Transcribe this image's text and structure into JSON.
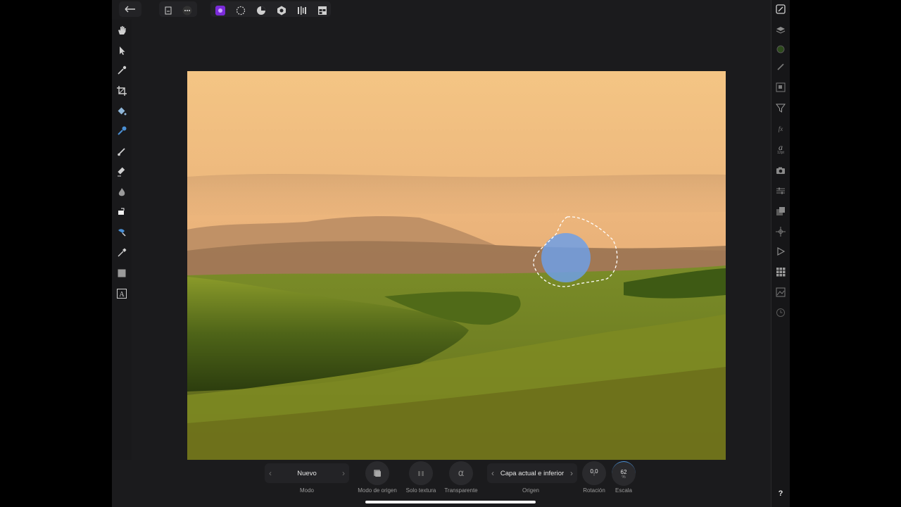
{
  "topbar": {
    "back_icon": "arrow-left-icon",
    "document_icon": "document-icon",
    "more_icon": "ellipsis-icon",
    "personas": [
      "photo-persona-icon",
      "liquify-persona-icon",
      "develop-persona-icon",
      "tone-map-persona-icon",
      "export-persona-icon",
      "grid-layout-icon"
    ],
    "accent": "#7b2bd9"
  },
  "left_tools": [
    "hand-icon",
    "move-icon",
    "color-picker-icon",
    "crop-icon",
    "fill-icon",
    "selection-brush-icon",
    "paint-brush-icon",
    "eraser-icon",
    "burn-icon",
    "clone-icon",
    "healing-icon",
    "pen-icon",
    "rectangle-icon",
    "text-icon"
  ],
  "right_tools": [
    "history-icon",
    "layers-icon",
    "color-icon",
    "brushes-icon",
    "navigator-icon",
    "filter-icon",
    "fx-icon",
    "text-styles-icon",
    "camera-icon",
    "adjustments-icon",
    "channels-icon",
    "transform-icon",
    "play-icon",
    "stock-icon",
    "image-icon",
    "clock-icon",
    "help-icon"
  ],
  "text_style_size": "12pt",
  "help_label": "?",
  "context": {
    "mode": {
      "value": "Nuevo",
      "label": "Modo"
    },
    "origin_mode_label": "Modo de origen",
    "texture_only_label": "Solo textura",
    "transparent_label": "Transparente",
    "origin": {
      "value": "Capa actual e inferior",
      "label": "Origen"
    },
    "rotation": {
      "value": "0,0",
      "unit": "°",
      "label": "Rotación"
    },
    "scale": {
      "value": "62",
      "unit": "%",
      "label": "Escala"
    }
  }
}
